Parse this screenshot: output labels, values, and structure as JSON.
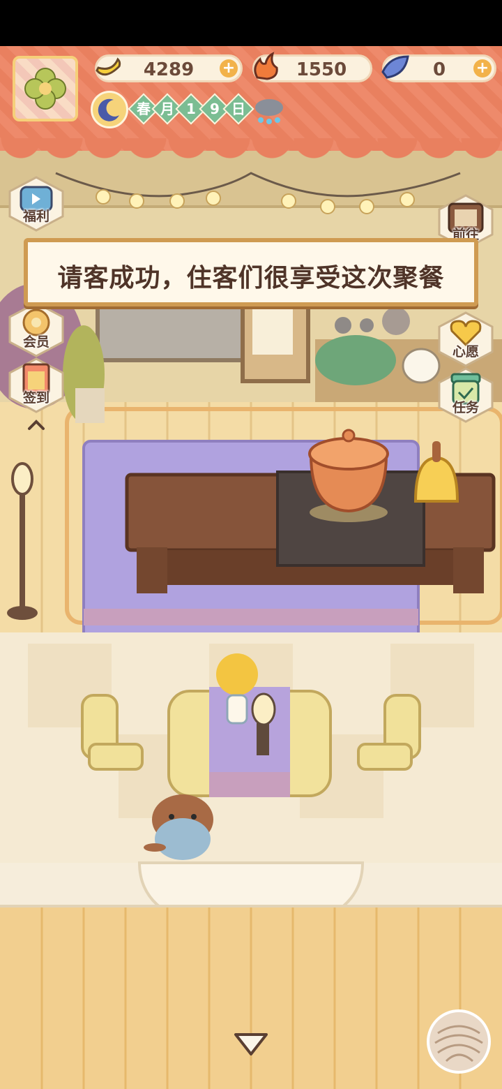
{
  "resources": {
    "banana": {
      "value": "4289",
      "plus": "+"
    },
    "chili": {
      "value": "1550"
    },
    "gem": {
      "value": "0",
      "plus": "+"
    }
  },
  "date": {
    "season": "春",
    "month": "月",
    "day1": "1",
    "day2": "9",
    "day_suffix": "日"
  },
  "weather_icon": "rain-cloud-icon",
  "side_left": [
    {
      "label": "福利",
      "icon": "tv-icon"
    },
    {
      "label": "会员",
      "icon": "flower-badge-icon"
    },
    {
      "label": "签到",
      "icon": "calendar-icon"
    }
  ],
  "side_right": [
    {
      "label": "前往",
      "icon": "signboard-icon"
    },
    {
      "label": "心愿",
      "icon": "heart-book-icon"
    },
    {
      "label": "任务",
      "icon": "checklist-jar-icon"
    }
  ],
  "message": "请客成功，住客们很享受这次聚餐",
  "colors": {
    "header": "#e9805f",
    "floor": "#f4dca6",
    "rug": "#a89ad8",
    "accent": "#f2b24a"
  }
}
